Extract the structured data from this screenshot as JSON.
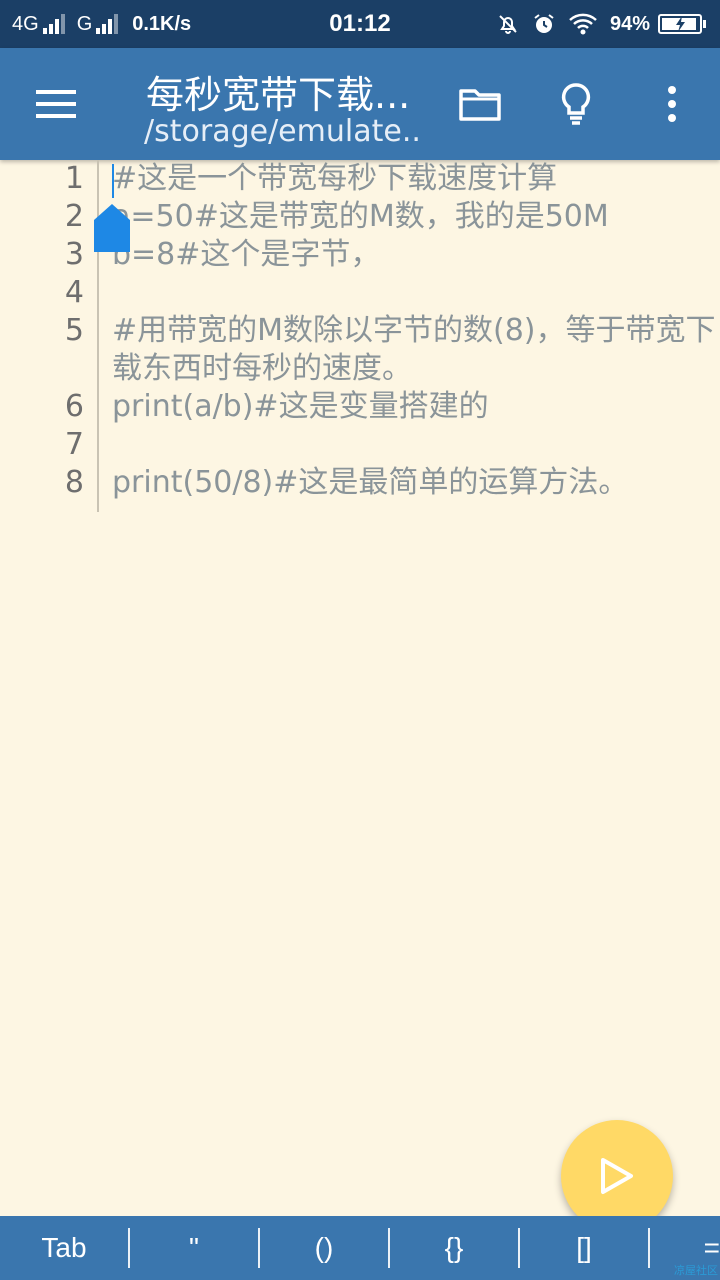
{
  "status_bar": {
    "network1": "4G",
    "network2": "G",
    "speed": "0.1K/s",
    "time": "01:12",
    "battery": "94%",
    "battery_level": 0.94,
    "icons": [
      "signal-icon",
      "mute-bell-icon",
      "alarm-icon",
      "wifi-icon",
      "battery-icon"
    ]
  },
  "toolbar": {
    "title": "每秒宽带下载...",
    "subtitle": "/storage/emulate...",
    "icons": [
      "menu-icon",
      "folder-icon",
      "lightbulb-icon",
      "more-vert-icon"
    ]
  },
  "editor": {
    "lines": [
      {
        "num": "1",
        "text": "#这是一个带宽每秒下载速度计算"
      },
      {
        "num": "2",
        "text": "a=50#这是带宽的M数，我的是50M"
      },
      {
        "num": "3",
        "text": "b=8#这个是字节，"
      },
      {
        "num": "4",
        "text": ""
      },
      {
        "num": "5",
        "text": "#用带宽的M数除以字节的数(8)，等于带宽下载东西时每秒的速度。"
      },
      {
        "num": "6",
        "text": "print(a/b)#这是变量搭建的"
      },
      {
        "num": "7",
        "text": ""
      },
      {
        "num": "8",
        "text": "print(50/8)#这是最简单的运算方法。"
      }
    ]
  },
  "fab": {
    "icon": "play-icon",
    "color": "#ffd966"
  },
  "keybar": {
    "keys": [
      "Tab",
      "\"",
      "()",
      "{}",
      "[]",
      "="
    ]
  },
  "watermark": "凉屋社区",
  "colors": {
    "status_bar": "#1b3f66",
    "toolbar": "#3a76ae",
    "editor_bg": "#fdf6e3",
    "accent": "#1e88e5"
  }
}
